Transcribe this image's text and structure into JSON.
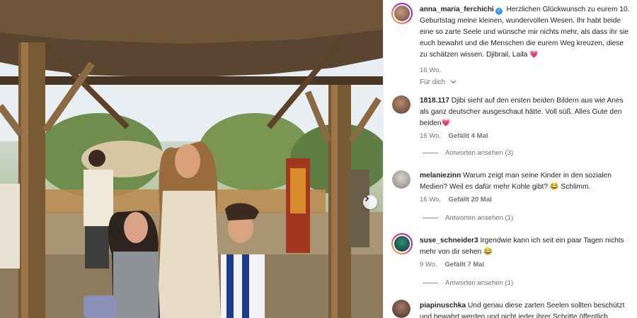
{
  "post": {
    "image_next_icon": "chevron-right-icon",
    "caption": {
      "username": "anna_maria_ferchichi",
      "text": "Herzlichen Glückwunsch zu eurem 10. Geburtstag meine kleinen, wundervollen Wesen. Ihr habt beide eine so zarte Seele und wünsche mir nichts mehr, als dass ihr sie euch bewahrt und die Menschen die eurem Weg kreuzen, diese zu schätzen wissen. Djibrail, Laila",
      "emoji": "💗",
      "time": "16 Wo."
    },
    "filter_label": "Für dich"
  },
  "comments": [
    {
      "username": "1818.117",
      "text": "Djibi sieht auf den ersten beiden Bildern aus wie Anes als ganz deutscher ausgeschaut hätte. Voll süß. Alles Gute den beiden",
      "emoji": "💗",
      "time": "16 Wo.",
      "likes": "Gefällt 4 Mal",
      "replies": "Antworten ansehen (3)"
    },
    {
      "username": "melaniezinn",
      "text": "Warum zeigt man seine Kinder in den sozialen Medien? Weil es dafür mehr Kohle gibt?",
      "emoji": "😂",
      "text_after": "Schlimm.",
      "time": "16 Wo.",
      "likes": "Gefällt 20 Mal",
      "replies": "Antworten ansehen (1)"
    },
    {
      "username": "suse_schneider3",
      "text": "Irgendwie kann ich seit ein paar Tagen nichts mehr von dir sehen",
      "emoji": "😂",
      "time": "9 Wo.",
      "likes": "Gefällt 7 Mal",
      "replies": "Antworten ansehen (1)"
    },
    {
      "username": "piapinuschka",
      "text": "Und genau diese zarten Seelen sollten beschützt und bewahrt werden und nicht jeder ihrer Schritte öffentlich"
    }
  ],
  "colors": {
    "verified": "#3897f0",
    "heart": "#ed4956",
    "secondary_text": "#737373"
  }
}
